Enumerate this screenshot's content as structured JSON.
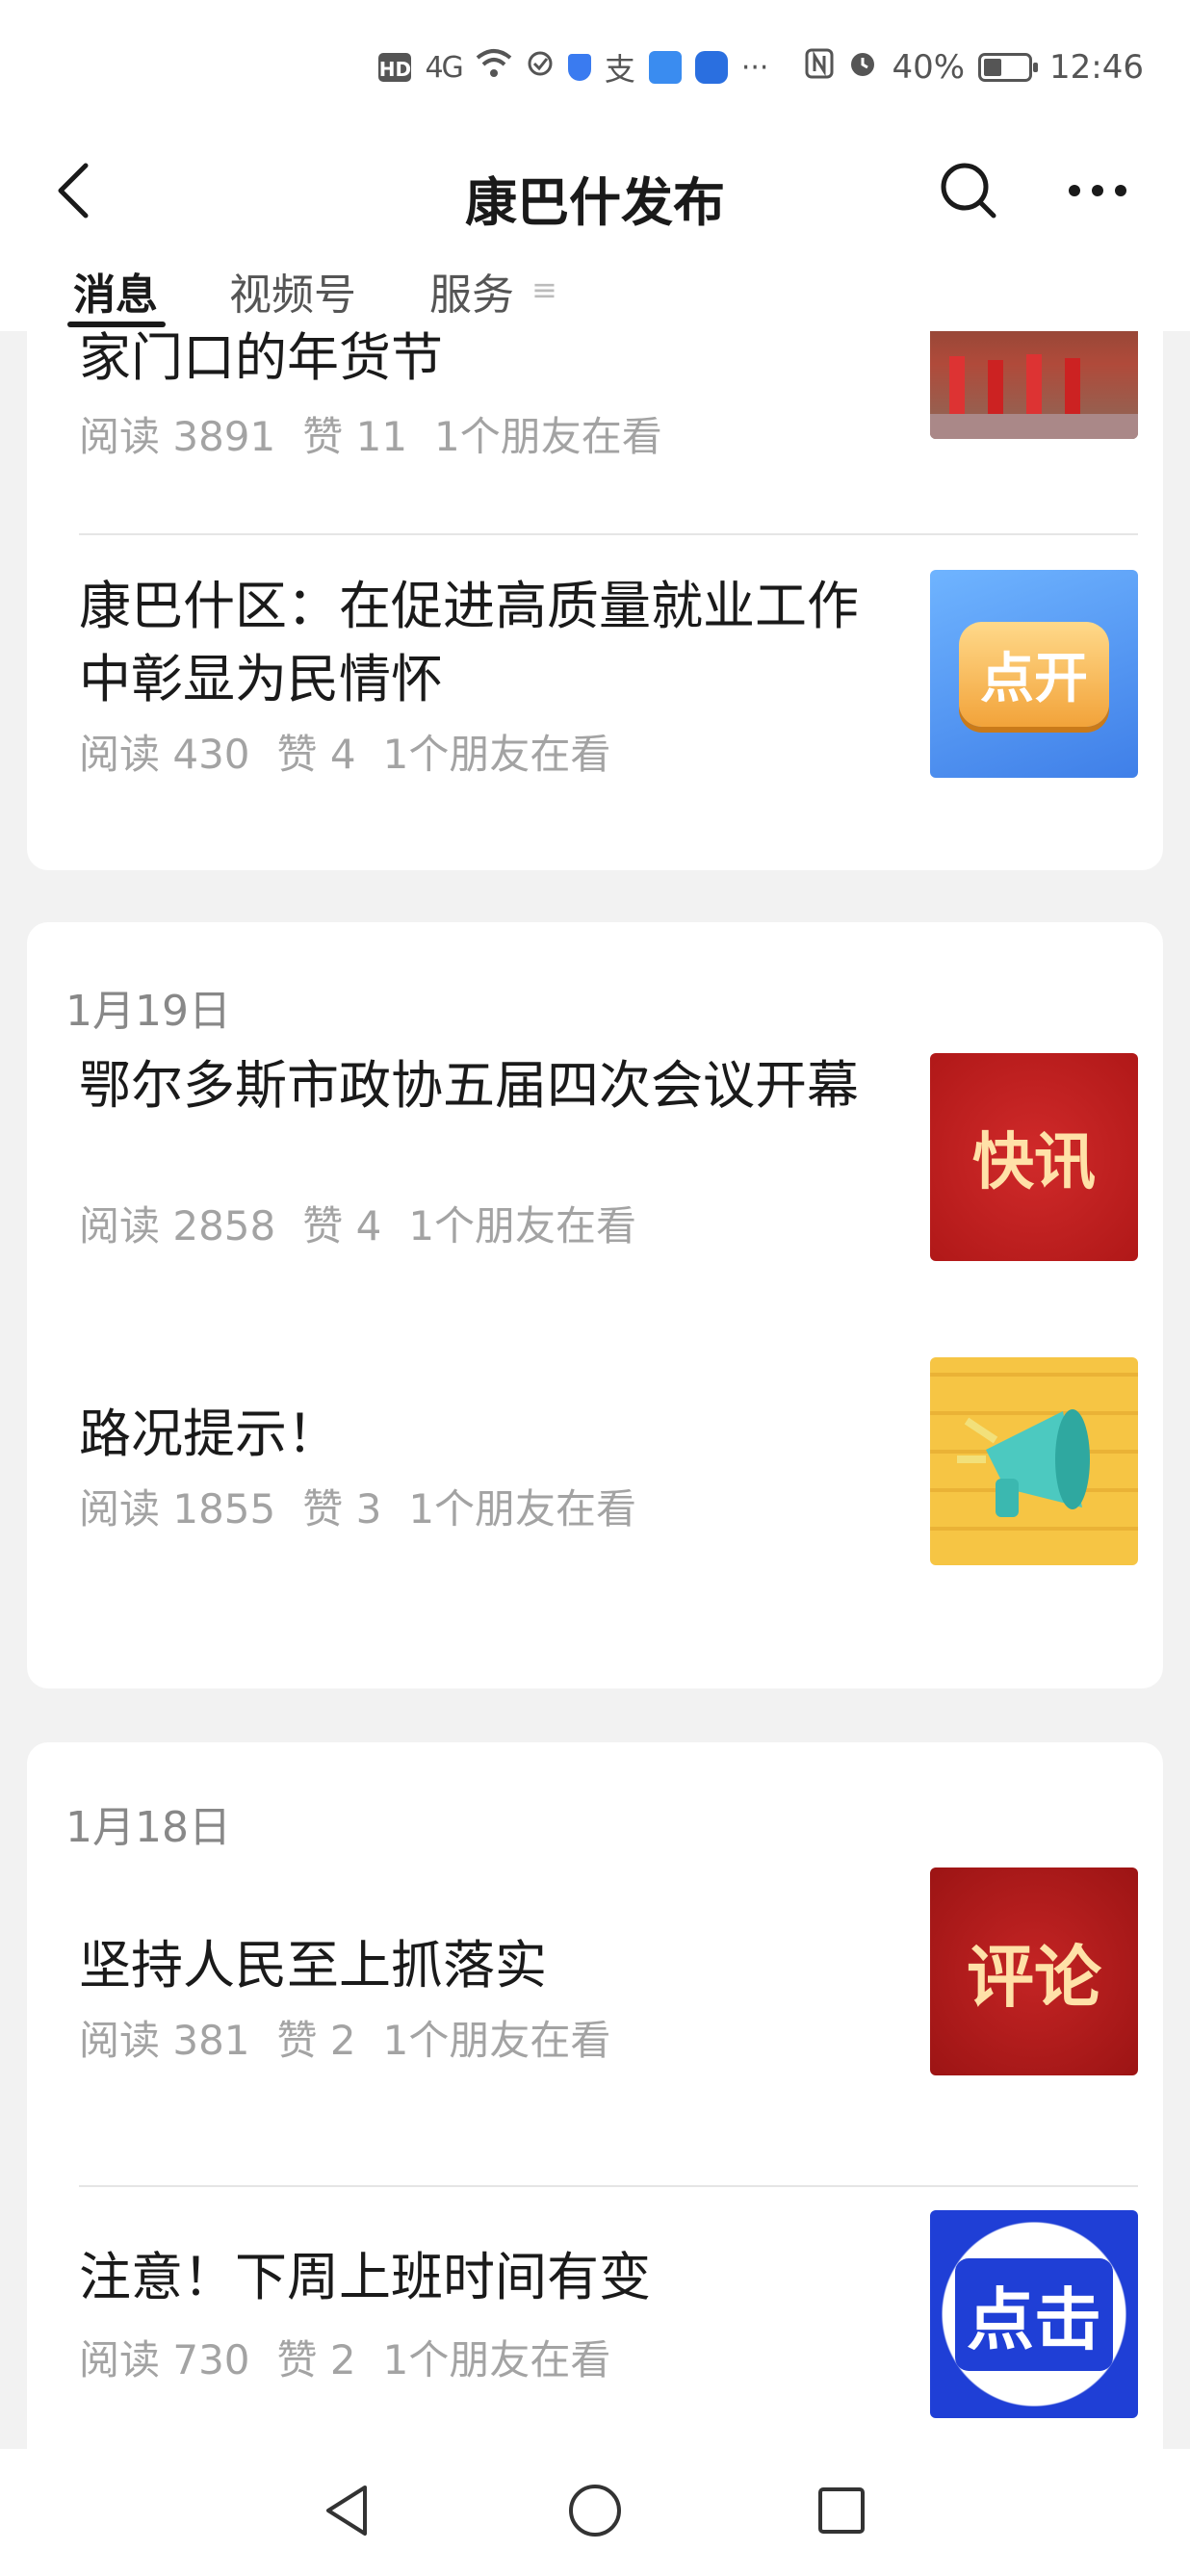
{
  "status_bar": {
    "hd": "HD",
    "signal": "4G",
    "battery": "40%",
    "time": "12:46",
    "more": "···"
  },
  "header": {
    "title": "康巴什发布"
  },
  "tabs": [
    {
      "label": "消息",
      "active": true
    },
    {
      "label": "视频号",
      "active": false
    },
    {
      "label": "服务",
      "active": false
    }
  ],
  "tab_overflow": "≡",
  "groups": [
    {
      "date": "",
      "articles": [
        {
          "title": "家门口的年货节",
          "reads": "阅读 3891",
          "likes": "赞 11",
          "friends": "1个朋友在看",
          "thumb_text": "",
          "thumb_color": "#a84a3a"
        },
        {
          "title": "康巴什区：在促进高质量就业工作中彰显为民情怀",
          "reads": "阅读 430",
          "likes": "赞 4",
          "friends": "1个朋友在看",
          "thumb_text": "点开",
          "thumb_color": "#4a90e8"
        }
      ]
    },
    {
      "date": "1月19日",
      "articles": [
        {
          "title": "鄂尔多斯市政协五届四次会议开幕",
          "reads": "阅读 2858",
          "likes": "赞 4",
          "friends": "1个朋友在看",
          "thumb_text": "快讯",
          "thumb_color": "#c21e1e"
        },
        {
          "title": "路况提示！",
          "reads": "阅读 1855",
          "likes": "赞 3",
          "friends": "1个朋友在看",
          "thumb_text": "",
          "thumb_color": "#f5c042"
        }
      ]
    },
    {
      "date": "1月18日",
      "articles": [
        {
          "title": "坚持人民至上抓落实",
          "reads": "阅读 381",
          "likes": "赞 2",
          "friends": "1个朋友在看",
          "thumb_text": "评论",
          "thumb_color": "#b01c1c"
        },
        {
          "title": "注意！下周上班时间有变",
          "reads": "阅读 730",
          "likes": "赞 2",
          "friends": "1个朋友在看",
          "thumb_text": "点击",
          "thumb_color": "#1f3fd6"
        }
      ]
    }
  ]
}
